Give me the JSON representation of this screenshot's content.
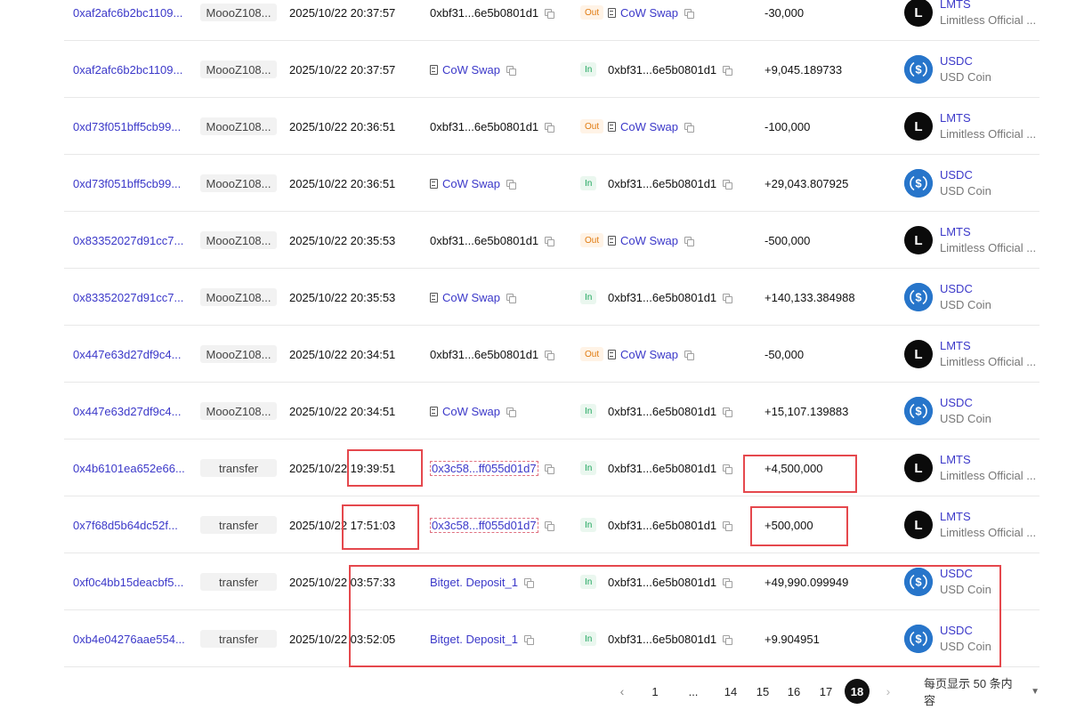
{
  "colors": {
    "link": "#3b38c9",
    "in_badge": "#1aa45a",
    "out_badge": "#e07b10",
    "highlight": "#e5484d",
    "usdc": "#2775ca",
    "lmts": "#0b0b0b"
  },
  "rows": [
    {
      "hash": "0xaf2afc6b2bc1109...",
      "method": "MoooZ108...",
      "time": "2025/10/22 20:37:57",
      "from": "0xbf31...6e5b0801d1",
      "from_type": "address",
      "dir": "Out",
      "to": "CoW Swap",
      "to_type": "contract",
      "amount": "-30,000",
      "token_symbol": "LMTS",
      "token_name": "Limitless Official ...",
      "token_logo": "L"
    },
    {
      "hash": "0xaf2afc6b2bc1109...",
      "method": "MoooZ108...",
      "time": "2025/10/22 20:37:57",
      "from": "CoW Swap",
      "from_type": "contract",
      "dir": "In",
      "to": "0xbf31...6e5b0801d1",
      "to_type": "address",
      "amount": "+9,045.189733",
      "token_symbol": "USDC",
      "token_name": "USD Coin",
      "token_logo": "usdc-coin-icon"
    },
    {
      "hash": "0xd73f051bff5cb99...",
      "method": "MoooZ108...",
      "time": "2025/10/22 20:36:51",
      "from": "0xbf31...6e5b0801d1",
      "from_type": "address",
      "dir": "Out",
      "to": "CoW Swap",
      "to_type": "contract",
      "amount": "-100,000",
      "token_symbol": "LMTS",
      "token_name": "Limitless Official ...",
      "token_logo": "L"
    },
    {
      "hash": "0xd73f051bff5cb99...",
      "method": "MoooZ108...",
      "time": "2025/10/22 20:36:51",
      "from": "CoW Swap",
      "from_type": "contract",
      "dir": "In",
      "to": "0xbf31...6e5b0801d1",
      "to_type": "address",
      "amount": "+29,043.807925",
      "token_symbol": "USDC",
      "token_name": "USD Coin",
      "token_logo": "usdc-coin-icon"
    },
    {
      "hash": "0x83352027d91cc7...",
      "method": "MoooZ108...",
      "time": "2025/10/22 20:35:53",
      "from": "0xbf31...6e5b0801d1",
      "from_type": "address",
      "dir": "Out",
      "to": "CoW Swap",
      "to_type": "contract",
      "amount": "-500,000",
      "token_symbol": "LMTS",
      "token_name": "Limitless Official ...",
      "token_logo": "L"
    },
    {
      "hash": "0x83352027d91cc7...",
      "method": "MoooZ108...",
      "time": "2025/10/22 20:35:53",
      "from": "CoW Swap",
      "from_type": "contract",
      "dir": "In",
      "to": "0xbf31...6e5b0801d1",
      "to_type": "address",
      "amount": "+140,133.384988",
      "token_symbol": "USDC",
      "token_name": "USD Coin",
      "token_logo": "usdc-coin-icon"
    },
    {
      "hash": "0x447e63d27df9c4...",
      "method": "MoooZ108...",
      "time": "2025/10/22 20:34:51",
      "from": "0xbf31...6e5b0801d1",
      "from_type": "address",
      "dir": "Out",
      "to": "CoW Swap",
      "to_type": "contract",
      "amount": "-50,000",
      "token_symbol": "LMTS",
      "token_name": "Limitless Official ...",
      "token_logo": "L"
    },
    {
      "hash": "0x447e63d27df9c4...",
      "method": "MoooZ108...",
      "time": "2025/10/22 20:34:51",
      "from": "CoW Swap",
      "from_type": "contract",
      "dir": "In",
      "to": "0xbf31...6e5b0801d1",
      "to_type": "address",
      "amount": "+15,107.139883",
      "token_symbol": "USDC",
      "token_name": "USD Coin",
      "token_logo": "usdc-coin-icon"
    },
    {
      "hash": "0x4b6101ea652e66...",
      "method": "transfer",
      "time": "2025/10/22 19:39:51",
      "from": "0x3c58...ff055d01d7",
      "from_type": "address-link",
      "dir": "In",
      "to": "0xbf31...6e5b0801d1",
      "to_type": "address",
      "amount": "+4,500,000",
      "token_symbol": "LMTS",
      "token_name": "Limitless Official ...",
      "token_logo": "L"
    },
    {
      "hash": "0x7f68d5b64dc52f...",
      "method": "transfer",
      "time": "2025/10/22 17:51:03",
      "from": "0x3c58...ff055d01d7",
      "from_type": "address-link",
      "dir": "In",
      "to": "0xbf31...6e5b0801d1",
      "to_type": "address",
      "amount": "+500,000",
      "token_symbol": "LMTS",
      "token_name": "Limitless Official ...",
      "token_logo": "L"
    },
    {
      "hash": "0xf0c4bb15deacbf5...",
      "method": "transfer",
      "time": "2025/10/22 03:57:33",
      "from": "Bitget. Deposit_1",
      "from_type": "label",
      "dir": "In",
      "to": "0xbf31...6e5b0801d1",
      "to_type": "address",
      "amount": "+49,990.099949",
      "token_symbol": "USDC",
      "token_name": "USD Coin",
      "token_logo": "usdc-coin-icon"
    },
    {
      "hash": "0xb4e04276aae554...",
      "method": "transfer",
      "time": "2025/10/22 03:52:05",
      "from": "Bitget. Deposit_1",
      "from_type": "label",
      "dir": "In",
      "to": "0xbf31...6e5b0801d1",
      "to_type": "address",
      "amount": "+9.904951",
      "token_symbol": "USDC",
      "token_name": "USD Coin",
      "token_logo": "usdc-coin-icon"
    }
  ],
  "pagination": {
    "prev_icon": "chevron-left-icon",
    "pages": [
      "1",
      "...",
      "14",
      "15",
      "16",
      "17",
      "18"
    ],
    "current": "18",
    "next_icon": "chevron-right-icon",
    "page_size": "每页显示 50 条内容"
  }
}
